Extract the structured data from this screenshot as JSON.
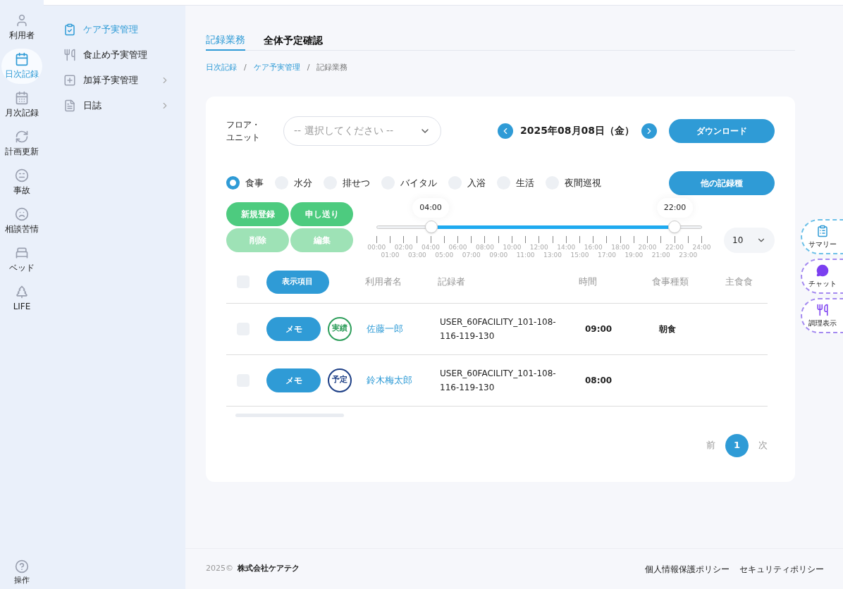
{
  "rail": [
    {
      "label": "利用者",
      "selected": false
    },
    {
      "label": "日次記録",
      "selected": true
    },
    {
      "label": "月次記録",
      "selected": false
    },
    {
      "label": "計画更新",
      "selected": false
    },
    {
      "label": "事故",
      "selected": false
    },
    {
      "label": "相談苦情",
      "selected": false
    },
    {
      "label": "ベッド",
      "selected": false
    },
    {
      "label": "LIFE",
      "selected": false
    }
  ],
  "rail_bottom": {
    "label": "操作"
  },
  "submenu": [
    {
      "label": "ケア予実管理",
      "selected": true,
      "has_children": false
    },
    {
      "label": "食止め予実管理",
      "selected": false,
      "has_children": false
    },
    {
      "label": "加算予実管理",
      "selected": false,
      "has_children": true
    },
    {
      "label": "日誌",
      "selected": false,
      "has_children": true
    }
  ],
  "tabs": [
    {
      "label": "記録業務",
      "selected": true
    },
    {
      "label": "全体予定確認",
      "selected": false
    }
  ],
  "breadcrumb": [
    {
      "label": "日次記録",
      "link": true
    },
    {
      "label": "ケア予実管理",
      "link": true
    },
    {
      "label": "記録業務",
      "link": false
    }
  ],
  "breadcrumb_separator": "/",
  "floor_label": "フロア・ユニット",
  "floor_select": {
    "placeholder": "-- 選択してください --"
  },
  "date": "2025年08月08日（金）",
  "download_button": "ダウンロード",
  "record_types": [
    {
      "label": "食事",
      "selected": true
    },
    {
      "label": "水分",
      "selected": false
    },
    {
      "label": "排せつ",
      "selected": false
    },
    {
      "label": "バイタル",
      "selected": false
    },
    {
      "label": "入浴",
      "selected": false
    },
    {
      "label": "生活",
      "selected": false
    },
    {
      "label": "夜間巡視",
      "selected": false
    }
  ],
  "other_records_button": "他の記録種",
  "actions": [
    {
      "label": "新規登録",
      "disabled": false
    },
    {
      "label": "申し送り",
      "disabled": false
    },
    {
      "label": "削除",
      "disabled": true
    },
    {
      "label": "編集",
      "disabled": true
    }
  ],
  "time_slider": {
    "thumbs": [
      {
        "label": "04:00",
        "level": 0.1667
      },
      {
        "label": "22:00",
        "level": 0.9167
      }
    ],
    "ticks": [
      "00:00",
      "01:00",
      "02:00",
      "03:00",
      "04:00",
      "05:00",
      "06:00",
      "07:00",
      "08:00",
      "09:00",
      "10:00",
      "11:00",
      "12:00",
      "13:00",
      "14:00",
      "15:00",
      "16:00",
      "17:00",
      "18:00",
      "19:00",
      "20:00",
      "21:00",
      "22:00",
      "23:00",
      "24:00"
    ]
  },
  "page_size": "10",
  "table": {
    "all_checked": false,
    "columns_button": "表示項目",
    "columns": [
      "利用者名",
      "記録者",
      "時間",
      "食事種類",
      "主食食"
    ],
    "rows": [
      {
        "checked": false,
        "memo": "メモ",
        "status": {
          "label": "実績",
          "color": "#2e9e5b"
        },
        "name": "佐藤一郎",
        "recorder": "USER_60FACILITY_101-108-116-119-130",
        "time": "09:00",
        "meal_type": "朝食"
      },
      {
        "checked": false,
        "memo": "メモ",
        "status": {
          "label": "予定",
          "color": "#1d3f86"
        },
        "name": "鈴木梅太郎",
        "recorder": "USER_60FACILITY_101-108-116-119-130",
        "time": "08:00"
      }
    ]
  },
  "pagination": {
    "prev": "前",
    "pages": [
      {
        "label": "1",
        "selected": true
      }
    ],
    "next": "次"
  },
  "floating": [
    {
      "label": "サマリー"
    },
    {
      "label": "チャット"
    },
    {
      "label": "調理表示"
    }
  ],
  "footer": {
    "year": "2025©",
    "company": "株式会社ケアテク",
    "links": [
      "個人情報保護ポリシー",
      "セキュリティポリシー"
    ]
  }
}
